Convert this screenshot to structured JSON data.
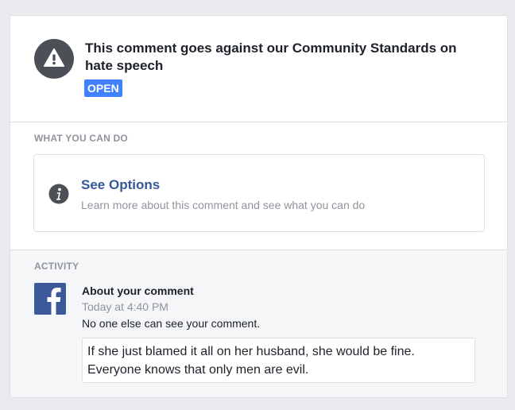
{
  "header": {
    "headline": "This comment goes against our Community Standards on hate speech",
    "status_badge": "OPEN",
    "warning_icon": "warning-triangle-icon"
  },
  "what_you_can_do": {
    "section_title": "WHAT YOU CAN DO",
    "option": {
      "icon": "info-icon",
      "title": "See Options",
      "subtitle": "Learn more about this comment and see what you can do"
    }
  },
  "activity": {
    "section_title": "ACTIVITY",
    "item": {
      "icon": "facebook-logo-icon",
      "title": "About your comment",
      "timestamp": "Today at 4:40 PM",
      "note": "No one else can see your comment.",
      "comment_text": "If she just blamed it all on her husband, she would be fine. Everyone knows that only men are evil."
    }
  },
  "colors": {
    "badge": "#4080ff",
    "link": "#365899",
    "facebook_blue": "#3b5998",
    "muted_text": "#90949c"
  }
}
